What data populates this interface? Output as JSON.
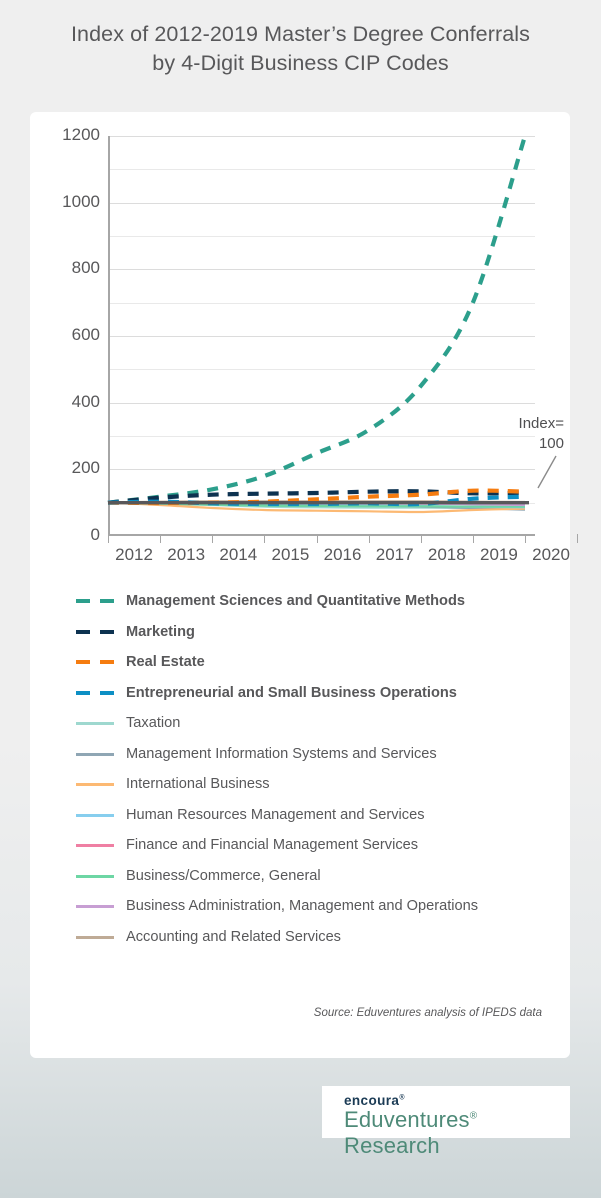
{
  "page": {
    "title": "Index of 2012-2019 Master’s Degree Conferrals by 4-Digit Business CIP Codes",
    "title_line1": "Index of 2012-2019 Master’s Degree Conferrals",
    "title_line2": "by 4-Digit Business CIP Codes",
    "source": "Source: Eduventures analysis of IPEDS data",
    "background_color": "#efefef",
    "card_color": "#ffffff"
  },
  "annotation": {
    "line1": "Index=",
    "line2": "100",
    "reference_value": 100,
    "reference_color": "#58585a"
  },
  "footer": {
    "logo_primary": "encoura",
    "logo_primary_mark": "®",
    "logo_secondary": "Eduventures",
    "logo_secondary_mark": "®",
    "logo_secondary_suffix": " Research",
    "logo_primary_color": "#1b3b55",
    "logo_secondary_color": "#4e8a78"
  },
  "chart_data": {
    "type": "line",
    "title": "Index of 2012-2019 Master’s Degree Conferrals by 4-Digit Business CIP Codes",
    "xlabel": "",
    "ylabel": "",
    "x": [
      2012,
      2013,
      2014,
      2015,
      2016,
      2017,
      2018,
      2019,
      2020
    ],
    "xtick_labels": [
      "2012",
      "2013",
      "2014",
      "2015",
      "2016",
      "2017",
      "2018",
      "2019",
      "2020"
    ],
    "ytick_labels": [
      "0",
      "200",
      "400",
      "600",
      "800",
      "1000",
      "1200"
    ],
    "yticks": [
      0,
      200,
      400,
      600,
      800,
      1000,
      1200
    ],
    "minor_yticks": [
      100,
      300,
      500,
      700,
      900,
      1100
    ],
    "ylim": [
      0,
      1200
    ],
    "grid": true,
    "legend_position": "below",
    "reference_line": {
      "value": 100,
      "label": "Index=100",
      "color": "#58585a"
    },
    "series": [
      {
        "name": "Management Sciences and Quantitative Methods",
        "color": "#2c9f8c",
        "style": "dashed",
        "emphasis": true,
        "values": [
          100,
          118,
          140,
          180,
          248,
          318,
          450,
          700,
          1200
        ]
      },
      {
        "name": "Marketing",
        "color": "#0d3250",
        "style": "dashed",
        "emphasis": true,
        "values": [
          100,
          115,
          124,
          127,
          129,
          133,
          134,
          128,
          130
        ]
      },
      {
        "name": "Real Estate",
        "color": "#f57c10",
        "style": "dashed",
        "emphasis": true,
        "values": [
          100,
          99,
          100,
          103,
          110,
          118,
          124,
          136,
          133
        ]
      },
      {
        "name": "Entrepreneurial and Small Business Operations",
        "color": "#0d8fc4",
        "style": "dashed",
        "emphasis": true,
        "values": [
          100,
          103,
          98,
          96,
          96,
          98,
          96,
          112,
          118
        ]
      },
      {
        "name": "Taxation",
        "color": "#9ed8cf",
        "style": "solid",
        "emphasis": false,
        "values": [
          100,
          97,
          93,
          88,
          86,
          85,
          85,
          84,
          84
        ]
      },
      {
        "name": "Management Information Systems and Services",
        "color": "#8fa6b4",
        "style": "solid",
        "emphasis": false,
        "values": [
          100,
          99,
          97,
          95,
          93,
          91,
          88,
          84,
          79
        ]
      },
      {
        "name": "International Business",
        "color": "#fcb973",
        "style": "solid",
        "emphasis": false,
        "values": [
          100,
          93,
          84,
          78,
          76,
          74,
          72,
          78,
          82
        ]
      },
      {
        "name": "Human Resources Management and Services",
        "color": "#87ceee",
        "style": "solid",
        "emphasis": false,
        "values": [
          100,
          98,
          96,
          94,
          92,
          91,
          90,
          88,
          86
        ]
      },
      {
        "name": "Finance and Financial Management Services",
        "color": "#ef7fa3",
        "style": "solid",
        "emphasis": false,
        "values": [
          100,
          101,
          101,
          100,
          100,
          99,
          98,
          96,
          94
        ]
      },
      {
        "name": "Business/Commerce, General",
        "color": "#6dd6a4",
        "style": "solid",
        "emphasis": false,
        "values": [
          100,
          97,
          94,
          91,
          90,
          89,
          89,
          88,
          88
        ]
      },
      {
        "name": "Business Administration, Management and Operations",
        "color": "#c79ed3",
        "style": "solid",
        "emphasis": false,
        "values": [
          100,
          100,
          99,
          99,
          98,
          98,
          97,
          95,
          93
        ]
      },
      {
        "name": "Accounting and Related Services",
        "color": "#bfab96",
        "style": "solid",
        "emphasis": false,
        "values": [
          100,
          103,
          104,
          104,
          104,
          104,
          104,
          103,
          102
        ]
      }
    ]
  },
  "legend": {
    "items": [
      {
        "label": "Management Sciences and Quantitative Methods",
        "color": "#2c9f8c",
        "style": "dashed",
        "bold": true
      },
      {
        "label": "Marketing",
        "color": "#0d3250",
        "style": "dashed",
        "bold": true
      },
      {
        "label": "Real Estate",
        "color": "#f57c10",
        "style": "dashed",
        "bold": true
      },
      {
        "label": "Entrepreneurial and Small Business Operations",
        "color": "#0d8fc4",
        "style": "dashed",
        "bold": true
      },
      {
        "label": "Taxation",
        "color": "#9ed8cf",
        "style": "solid",
        "bold": false
      },
      {
        "label": "Management Information Systems and Services",
        "color": "#8fa6b4",
        "style": "solid",
        "bold": false
      },
      {
        "label": "International Business",
        "color": "#fcb973",
        "style": "solid",
        "bold": false
      },
      {
        "label": "Human Resources Management and Services",
        "color": "#87ceee",
        "style": "solid",
        "bold": false
      },
      {
        "label": "Finance and Financial Management Services",
        "color": "#ef7fa3",
        "style": "solid",
        "bold": false
      },
      {
        "label": "Business/Commerce, General",
        "color": "#6dd6a4",
        "style": "solid",
        "bold": false
      },
      {
        "label": "Business Administration, Management and Operations",
        "color": "#c79ed3",
        "style": "solid",
        "bold": false
      },
      {
        "label": "Accounting and Related Services",
        "color": "#bfab96",
        "style": "solid",
        "bold": false
      }
    ]
  }
}
